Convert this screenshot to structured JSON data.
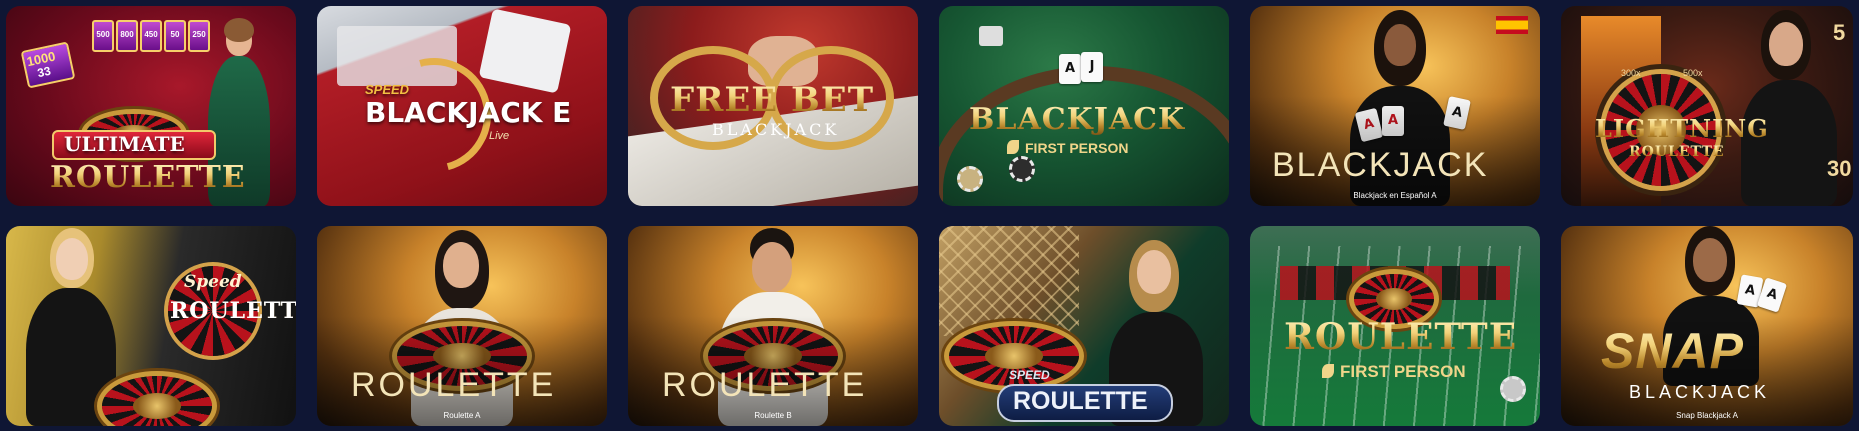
{
  "games": [
    {
      "title": "ULTIMATE",
      "subtitle": "ROULETTE",
      "caption": "",
      "multipliers": [
        "1000",
        "500",
        "800",
        "450",
        "50",
        "250"
      ],
      "score": "33"
    },
    {
      "speed": "SPEED",
      "title": "BLACKJACK E",
      "badge": "Live",
      "caption": ""
    },
    {
      "title": "FREE BET",
      "subtitle": "BLACKJACK",
      "caption": ""
    },
    {
      "title": "BLACKJACK",
      "subtitle": "FIRST PERSON",
      "caption": "",
      "cards": [
        "A",
        "J"
      ]
    },
    {
      "title": "BLACKJACK",
      "caption": "Blackjack en Español A",
      "cards": [
        "A",
        "A",
        "A"
      ]
    },
    {
      "title": "LIGHTNING",
      "subtitle": "ROULETTE",
      "caption": "",
      "bet_labels": [
        "300x",
        "500x"
      ],
      "side_numbers": [
        "5",
        "30"
      ]
    },
    {
      "speed": "Speed",
      "title": "ROULETTE",
      "caption": ""
    },
    {
      "title": "ROULETTE",
      "caption": "Roulette A"
    },
    {
      "title": "ROULETTE",
      "caption": "Roulette B"
    },
    {
      "speed": "SPEED",
      "title": "ROULETTE",
      "caption": ""
    },
    {
      "title": "ROULETTE",
      "subtitle": "FIRST PERSON",
      "caption": ""
    },
    {
      "title": "SNAP",
      "subtitle": "BLACKJACK",
      "caption": "Snap Blackjack A",
      "cards": [
        "A",
        "A"
      ]
    }
  ],
  "colors": {
    "page_background": "#0f1634",
    "gold": "#f0d58a",
    "red": "#b8121c"
  },
  "icons": {
    "flag": "spain-flag-icon",
    "first_person": "leaf-icon"
  }
}
